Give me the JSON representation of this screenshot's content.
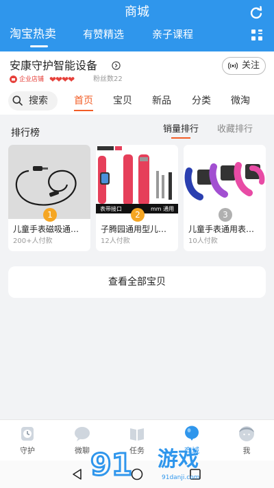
{
  "header": {
    "title": "商城",
    "tabs": [
      {
        "label": "淘宝热卖",
        "active": true
      },
      {
        "label": "有赞精选",
        "active": false
      },
      {
        "label": "亲子课程",
        "active": false
      }
    ],
    "bg_color": "#2f96ec"
  },
  "shop": {
    "name": "安康守护智能设备",
    "enterprise_label": "企业店铺",
    "hearts": "❤❤❤❤",
    "fans": "粉丝数22",
    "follow_label": "关注"
  },
  "nav": {
    "search_label": "搜索",
    "items": [
      {
        "label": "首页",
        "active": true
      },
      {
        "label": "宝贝",
        "active": false
      },
      {
        "label": "新品",
        "active": false
      },
      {
        "label": "分类",
        "active": false
      },
      {
        "label": "微淘",
        "active": false
      }
    ]
  },
  "ranking": {
    "title": "排行榜",
    "sort_sales": "销量排行",
    "sort_favorites": "收藏排行",
    "items": [
      {
        "rank": "1",
        "name": "儿童手表磁吸通用充电线",
        "sold": "200+人付款",
        "rank_color": "#f5a623"
      },
      {
        "rank": "2",
        "name": "子腾园通用型儿童手表表带",
        "sold": "12人付款",
        "rank_color": "#f5a623"
      },
      {
        "rank": "3",
        "name": "儿童手表通用表带硅胶",
        "sold": "10人付款",
        "rank_color": "#b0b0b0"
      }
    ],
    "product2_overlay": "表带接口",
    "product2_overlay_right": "mm 通用"
  },
  "view_all_label": "查看全部宝贝",
  "tabbar": {
    "items": [
      {
        "label": "守护",
        "icon": "clock-icon",
        "active": false
      },
      {
        "label": "微聊",
        "icon": "chat-bubble-icon",
        "active": false
      },
      {
        "label": "任务",
        "icon": "book-icon",
        "active": false
      },
      {
        "label": "商城",
        "icon": "balloon-icon",
        "active": true
      },
      {
        "label": "我",
        "icon": "face-icon",
        "active": false
      }
    ]
  },
  "watermark": {
    "text": "游戏",
    "sub": "91danji.com"
  },
  "colors": {
    "accent": "#2f96ec",
    "active_orange": "#f25d26",
    "heart_red": "#e6403a"
  }
}
